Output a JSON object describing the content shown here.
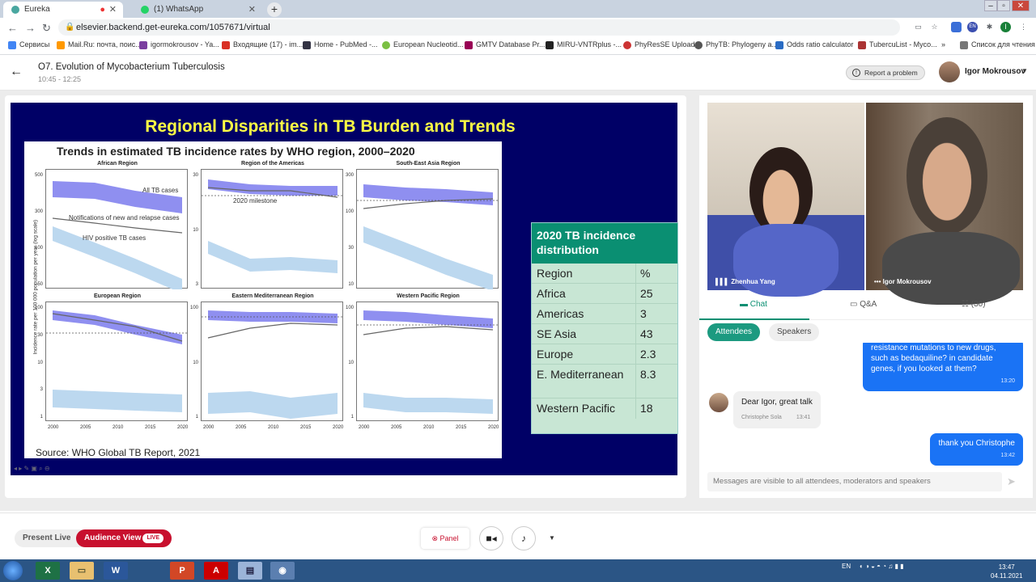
{
  "browser": {
    "tabs": [
      {
        "label": "Eureka",
        "active": true
      },
      {
        "label": "(1) WhatsApp",
        "active": false
      }
    ],
    "url": "elsevier.backend.get-eureka.com/1057671/virtual",
    "bookmarks": [
      "Сервисы",
      "Mail.Ru: почта, поис...",
      "igormokrousov - Ya...",
      "Входящие (17) - im...",
      "Home - PubMed -...",
      "European Nucleotid...",
      "GMTV Database Pr...",
      "MIRU-VNTRplus -...",
      "PhyResSE Upload",
      "PhyTB: Phylogeny a...",
      "Odds ratio calculator",
      "TubercuList - Myco...",
      "Список для чтения"
    ],
    "profile_initial": "I",
    "ext_label": "EN"
  },
  "session": {
    "title": "O7. Evolution of Mycobacterium Tuberculosis",
    "time": "10:45 - 12:25",
    "report_label": "Report a problem",
    "user_name": "Igor Mokrousov"
  },
  "slide": {
    "title": "Regional Disparities in TB Burden and Trends",
    "figure_title": "Trends in estimated TB incidence rates by WHO region, 2000–2020",
    "y_axis_label": "Incidence rate per 100 000 population per year (log scale)",
    "annotations": [
      "All TB cases",
      "Notifications of new and relapse cases",
      "HIV positive TB cases",
      "2020 milestone"
    ],
    "source": "Source: WHO Global TB Report, 2021",
    "x_ticks": [
      "2000",
      "2005",
      "2010",
      "2015",
      "2020"
    ],
    "panels": [
      {
        "title": "African Region",
        "yticks": [
          "500",
          "300",
          "100",
          "50"
        ]
      },
      {
        "title": "Region of the Americas",
        "yticks": [
          "30",
          "10",
          "3"
        ]
      },
      {
        "title": "South-East Asia Region",
        "yticks": [
          "300",
          "100",
          "30",
          "10"
        ]
      },
      {
        "title": "European Region",
        "yticks": [
          "100",
          "30",
          "10",
          "3",
          "1"
        ]
      },
      {
        "title": "Eastern Mediterranean Region",
        "yticks": [
          "100",
          "10",
          "1"
        ]
      },
      {
        "title": "Western Pacific Region",
        "yticks": [
          "100",
          "10",
          "1"
        ]
      }
    ],
    "distribution": {
      "title": "2020 TB incidence distribution",
      "header": {
        "region": "Region",
        "pct": "%"
      },
      "rows": [
        {
          "region": "Africa",
          "pct": "25"
        },
        {
          "region": "Americas",
          "pct": "3"
        },
        {
          "region": "SE Asia",
          "pct": "43"
        },
        {
          "region": "Europe",
          "pct": "2.3"
        },
        {
          "region": "E. Mediterranean",
          "pct": "8.3"
        },
        {
          "region": "Western Pacific",
          "pct": "18"
        }
      ]
    }
  },
  "video": {
    "speaker1": "Zhenhua Yang",
    "speaker2": "Igor Mokrousov"
  },
  "chat": {
    "tabs": {
      "chat": "Chat",
      "qa": "Q&A",
      "people": "(30)"
    },
    "filters": {
      "attendees": "Attendees",
      "speakers": "Speakers"
    },
    "messages": [
      {
        "from": "me",
        "text": "resistance mutations to new drugs, such as bedaquiline? in candidate genes, if you looked at them?",
        "time": "13:20"
      },
      {
        "from": "Christophe Sola",
        "text": "Dear Igor, great talk",
        "time": "13:41"
      },
      {
        "from": "me",
        "text": "thank you Christophe",
        "time": "13:42"
      }
    ],
    "composer_placeholder": "Messages are visible to all attendees, moderators and speakers"
  },
  "controls": {
    "present_live": "Present Live",
    "audience_view": "Audience View",
    "live_badge": "LIVE",
    "panel": "Panel"
  },
  "taskbar": {
    "lang": "EN",
    "time": "13:47",
    "date": "04.11.2021"
  }
}
